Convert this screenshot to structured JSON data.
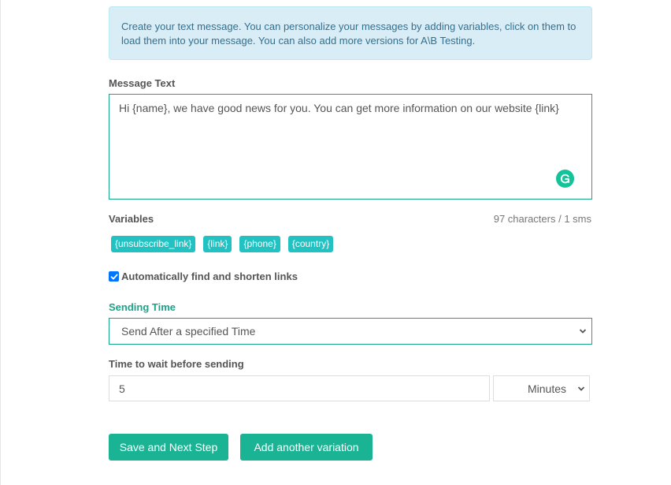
{
  "info_alert": {
    "text": "Create your text message. You can personalize your messages by adding variables, click on them to load them into your message. You can also add more versions for A\\B Testing."
  },
  "message": {
    "label": "Message Text",
    "value": "Hi {name}, we have good news for you. You can get more information on our website {link}",
    "char_count": "97 characters / 1 sms",
    "grammarly_icon": "grammarly-icon"
  },
  "variables": {
    "label": "Variables",
    "items": [
      "{unsubscribe_link}",
      "{link}",
      "{phone}",
      "{country}"
    ]
  },
  "shorten_links": {
    "label": "Automatically find and shorten links",
    "checked": true
  },
  "sending_time": {
    "label": "Sending Time",
    "selected": "Send After a specified Time"
  },
  "wait_time": {
    "label": "Time to wait before sending",
    "value": "5",
    "unit": "Minutes"
  },
  "buttons": {
    "save": "Save and Next Step",
    "add_variation": "Add another variation"
  },
  "colors": {
    "accent": "#1ab394",
    "variable_chip": "#22c2c2",
    "info_bg": "#d9edf7"
  }
}
